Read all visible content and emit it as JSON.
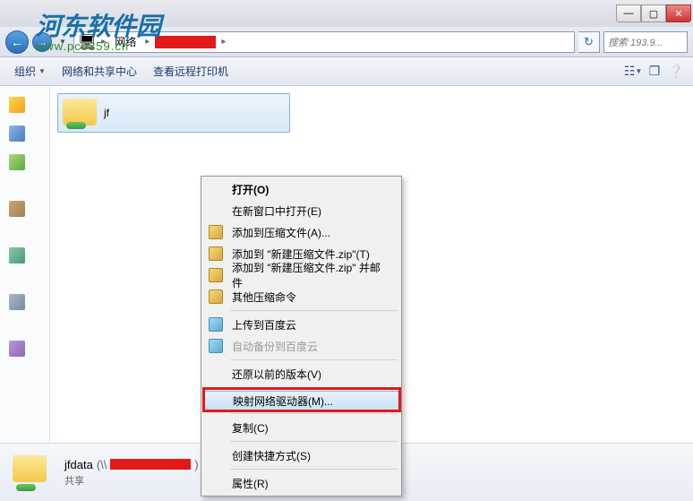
{
  "watermark": {
    "main": "河东软件园",
    "sub": "www.pc0359.cn"
  },
  "titlebar": {
    "min": "—",
    "max": "▢",
    "close": "✕"
  },
  "addr": {
    "back": "←",
    "fwd": "→",
    "drop": "▼",
    "crumb1": "网络",
    "sep": "▸",
    "refresh": "↻",
    "search_placeholder": "搜索 193.9..."
  },
  "toolbar": {
    "organize": "组织",
    "drop": "▼",
    "netcenter": "网络和共享中心",
    "remote_printer": "查看远程打印机",
    "view": "☷",
    "preview": "❐",
    "help": "❔"
  },
  "content": {
    "folder_name": "jf"
  },
  "ctx": {
    "open": "打开(O)",
    "open_new": "在新窗口中打开(E)",
    "add_archive": "添加到压缩文件(A)...",
    "add_zip": "添加到 \"新建压缩文件.zip\"(T)",
    "add_zip_mail": "添加到 \"新建压缩文件.zip\" 并邮件",
    "other_zip": "其他压缩命令",
    "upload_baidu": "上传到百度云",
    "auto_backup": "自动备份到百度云",
    "restore": "还原以前的版本(V)",
    "map_drive": "映射网络驱动器(M)...",
    "copy": "复制(C)",
    "shortcut": "创建快捷方式(S)",
    "properties": "属性(R)"
  },
  "details": {
    "name": "jfdata",
    "sub": "共享"
  }
}
